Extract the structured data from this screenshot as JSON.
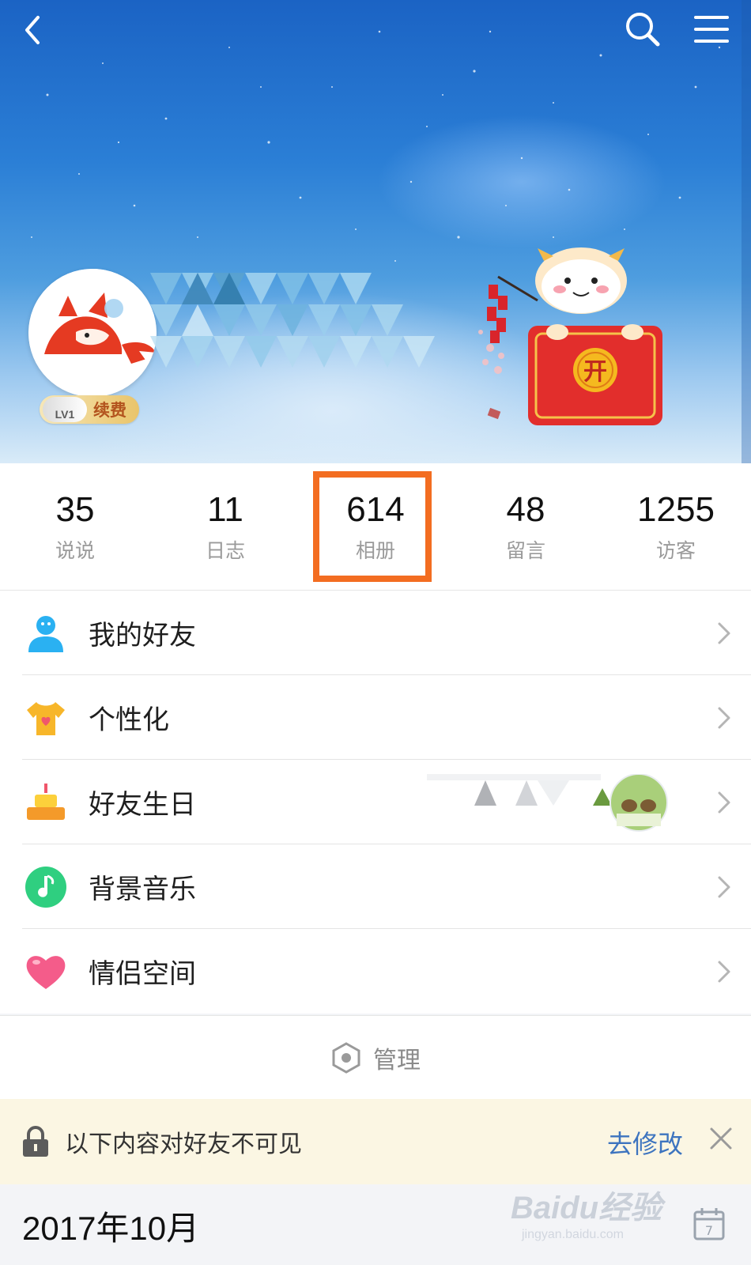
{
  "header": {
    "level": "LV1",
    "renew_label": "续费",
    "mascot_badge": "开"
  },
  "stats": [
    {
      "value": "35",
      "label": "说说"
    },
    {
      "value": "11",
      "label": "日志"
    },
    {
      "value": "614",
      "label": "相册"
    },
    {
      "value": "48",
      "label": "留言"
    },
    {
      "value": "1255",
      "label": "访客"
    }
  ],
  "menu": [
    {
      "label": "我的好友",
      "icon": "friend-icon"
    },
    {
      "label": "个性化",
      "icon": "tshirt-icon"
    },
    {
      "label": "好友生日",
      "icon": "cake-icon"
    },
    {
      "label": "背景音乐",
      "icon": "music-icon"
    },
    {
      "label": "情侣空间",
      "icon": "heart-icon"
    }
  ],
  "manage_label": "管理",
  "notice": {
    "text": "以下内容对好友不可见",
    "action": "去修改"
  },
  "date_label": "2017年10月",
  "watermark": {
    "brand": "Baidu经验",
    "sub": "jingyan.baidu.com"
  },
  "colors": {
    "highlight": "#f36d21",
    "link": "#3d74bf",
    "notice_bg": "#fbf6e3"
  }
}
